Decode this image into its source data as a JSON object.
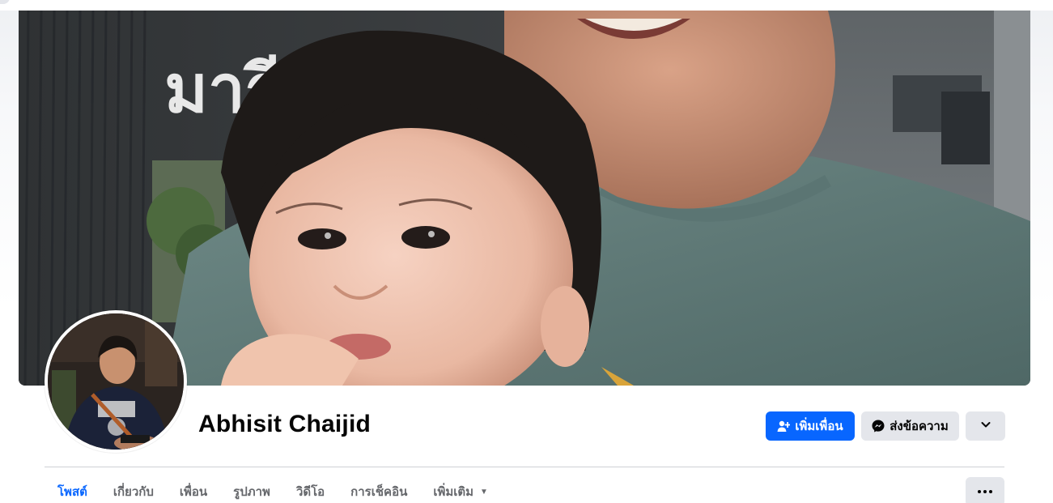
{
  "profile": {
    "name": "Abhisit Chaijid"
  },
  "cover": {
    "sign_text": "มารี"
  },
  "actions": {
    "add_friend_label": "เพิ่มเพื่อน",
    "message_label": "ส่งข้อความ",
    "add_friend_icon": "person-plus-icon",
    "message_icon": "messenger-icon",
    "more_icon": "chevron-down-icon"
  },
  "tabs": [
    {
      "label": "โพสต์",
      "active": true
    },
    {
      "label": "เกี่ยวกับ",
      "active": false
    },
    {
      "label": "เพื่อน",
      "active": false
    },
    {
      "label": "รูปภาพ",
      "active": false
    },
    {
      "label": "วิดีโอ",
      "active": false
    },
    {
      "label": "การเช็คอิน",
      "active": false
    },
    {
      "label": "เพิ่มเติม",
      "active": false
    }
  ],
  "colors": {
    "accent": "#0866ff",
    "secondary_button": "#e4e6eb",
    "text_primary": "#050505",
    "text_secondary": "#65676b"
  }
}
